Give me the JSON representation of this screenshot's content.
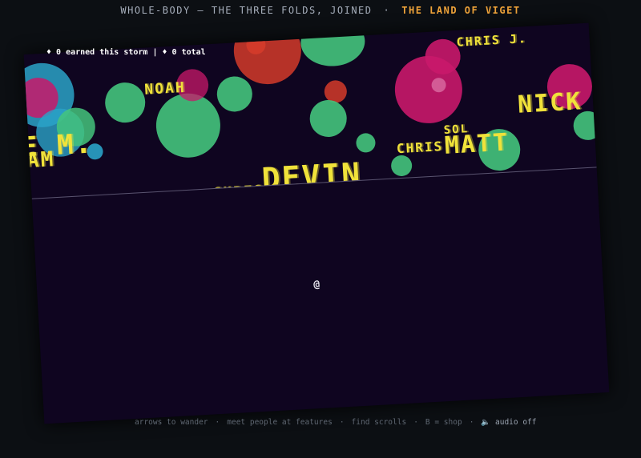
{
  "header": {
    "subtitle": "WHOLE-BODY — THE THREE FOLDS, JOINED",
    "separator": "·",
    "land_title": "THE LAND OF VIGET"
  },
  "hud": {
    "earned": "♦ 0 earned this storm | ♦ 0 total"
  },
  "player": {
    "avatar": "@"
  },
  "storm": {
    "names": [
      "NOAH",
      "CHRIS J.",
      "NICK",
      "E M.",
      "AM",
      "SOL",
      "CHRIS",
      "MATT",
      "DEVIN",
      "CHRIS",
      "CHRIS J."
    ],
    "colors": {
      "green": "#44c47c",
      "magenta": "#c9186a",
      "red": "#d43b2a",
      "cyan": "#2aa3c8",
      "yellow": "#f0e23a",
      "background": "#0f0520"
    }
  },
  "footer": {
    "hint_wander": "arrows to wander",
    "hint_meet": "meet people at features",
    "hint_scrolls": "find scrolls",
    "hint_shop": "B = shop",
    "audio_label": "audio off",
    "separator": "·"
  }
}
